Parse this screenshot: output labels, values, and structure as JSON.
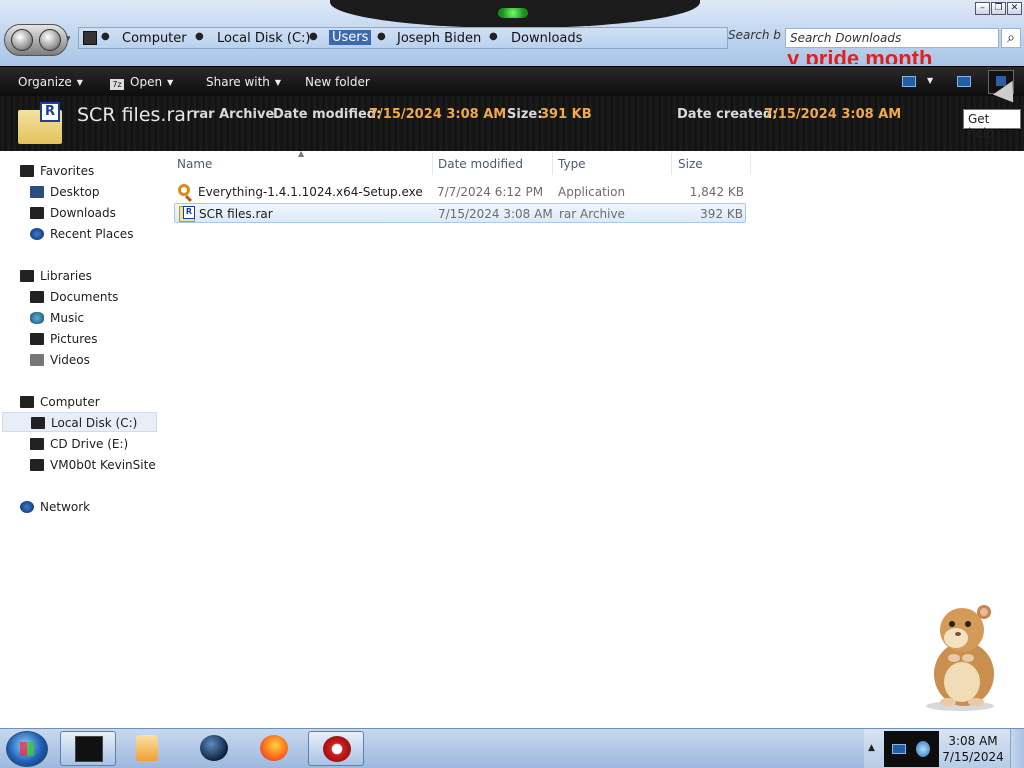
{
  "window": {
    "breadcrumbs": [
      "Computer",
      "Local Disk (C:)",
      "Users",
      "Joseph Biden",
      "Downloads"
    ],
    "search_button": "Search b",
    "search_placeholder": "Search Downloads",
    "banner_text": "y pride month",
    "controls": [
      "minimize",
      "restore",
      "close"
    ]
  },
  "toolbar": {
    "organize": "Organize",
    "open": "Open",
    "share_with": "Share with",
    "new_folder": "New folder",
    "help_tooltip": "Get help."
  },
  "details": {
    "name": "SCR files.rar",
    "type": "rar Archive",
    "modified_label": "Date modified:",
    "modified_value": "7/15/2024 3:08 AM",
    "size_label": "Size:",
    "size_value": "391 KB",
    "created_label": "Date created:",
    "created_value": "7/15/2024 3:08 AM"
  },
  "nav": {
    "favorites": "Favorites",
    "desktop": "Desktop",
    "downloads": "Downloads",
    "recent": "Recent Places",
    "libraries": "Libraries",
    "documents": "Documents",
    "music": "Music",
    "pictures": "Pictures",
    "videos": "Videos",
    "computer": "Computer",
    "local_disk": "Local Disk (C:)",
    "cd_drive": "CD Drive (E:)",
    "site": "VM0b0t KevinSite",
    "network": "Network"
  },
  "columns": {
    "name": "Name",
    "modified": "Date modified",
    "type": "Type",
    "size": "Size"
  },
  "files": [
    {
      "name": "Everything-1.4.1.1024.x64-Setup.exe",
      "modified": "7/7/2024 6:12 PM",
      "type": "Application",
      "size": "1,842 KB",
      "icon": "search-icon"
    },
    {
      "name": "SCR files.rar",
      "modified": "7/15/2024 3:08 AM",
      "type": "rar Archive",
      "size": "392 KB",
      "icon": "rar-archive-icon"
    }
  ],
  "taskbar": {
    "time": "3:08 AM",
    "date": "7/15/2024",
    "apps": [
      "explorer",
      "media-player",
      "globe",
      "firefox",
      "chrome-like"
    ]
  },
  "colors": {
    "accent": "#3c6ab0",
    "details_value": "#f1a94a",
    "banner": "#e02020"
  }
}
